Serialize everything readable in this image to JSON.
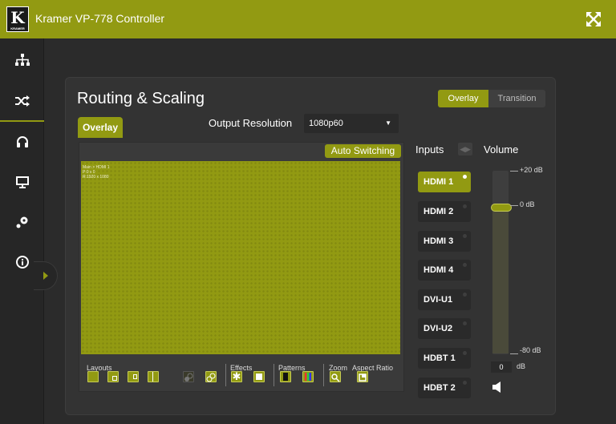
{
  "app": {
    "title": "Kramer VP-778 Controller",
    "logo_glyph": "K",
    "logo_text": "KRAMER"
  },
  "sidebar": {
    "items": [
      {
        "icon": "network-icon",
        "active": false
      },
      {
        "icon": "shuffle-icon",
        "active": true
      },
      {
        "icon": "headphones-icon",
        "active": false
      },
      {
        "icon": "monitor-icon",
        "active": false
      },
      {
        "icon": "settings-dots-icon",
        "active": false
      },
      {
        "icon": "info-icon",
        "active": false
      }
    ]
  },
  "panel": {
    "title": "Routing & Scaling",
    "mode_tabs": [
      "Overlay",
      "Transition"
    ],
    "active_tab": "Overlay",
    "output_resolution_label": "Output Resolution",
    "output_resolution_value": "1080p60",
    "auto_switching_label": "Auto Switching",
    "preview_info": [
      "Main > HDMI 1",
      "P:0 x 0",
      "R:1920 x 1080"
    ]
  },
  "tools": {
    "layouts_label": "Layouts",
    "effects_label": "Effects",
    "patterns_label": "Patterns",
    "zoom_label": "Zoom",
    "aspect_label": "Aspect Ratio"
  },
  "inputs": {
    "label": "Inputs",
    "items": [
      "HDMI 1",
      "HDMI 2",
      "HDMI 3",
      "HDMI 4",
      "DVI-U1",
      "DVI-U2",
      "HDBT 1",
      "HDBT 2"
    ],
    "active_index": 0
  },
  "volume": {
    "label": "Volume",
    "max_label": "+20 dB",
    "mid_label": "0 dB",
    "min_label": "-80 dB",
    "value": "0",
    "unit": "dB",
    "level_db": 0
  },
  "colors": {
    "accent": "#929a12",
    "background": "#2b2b2b",
    "panel": "#333333"
  }
}
